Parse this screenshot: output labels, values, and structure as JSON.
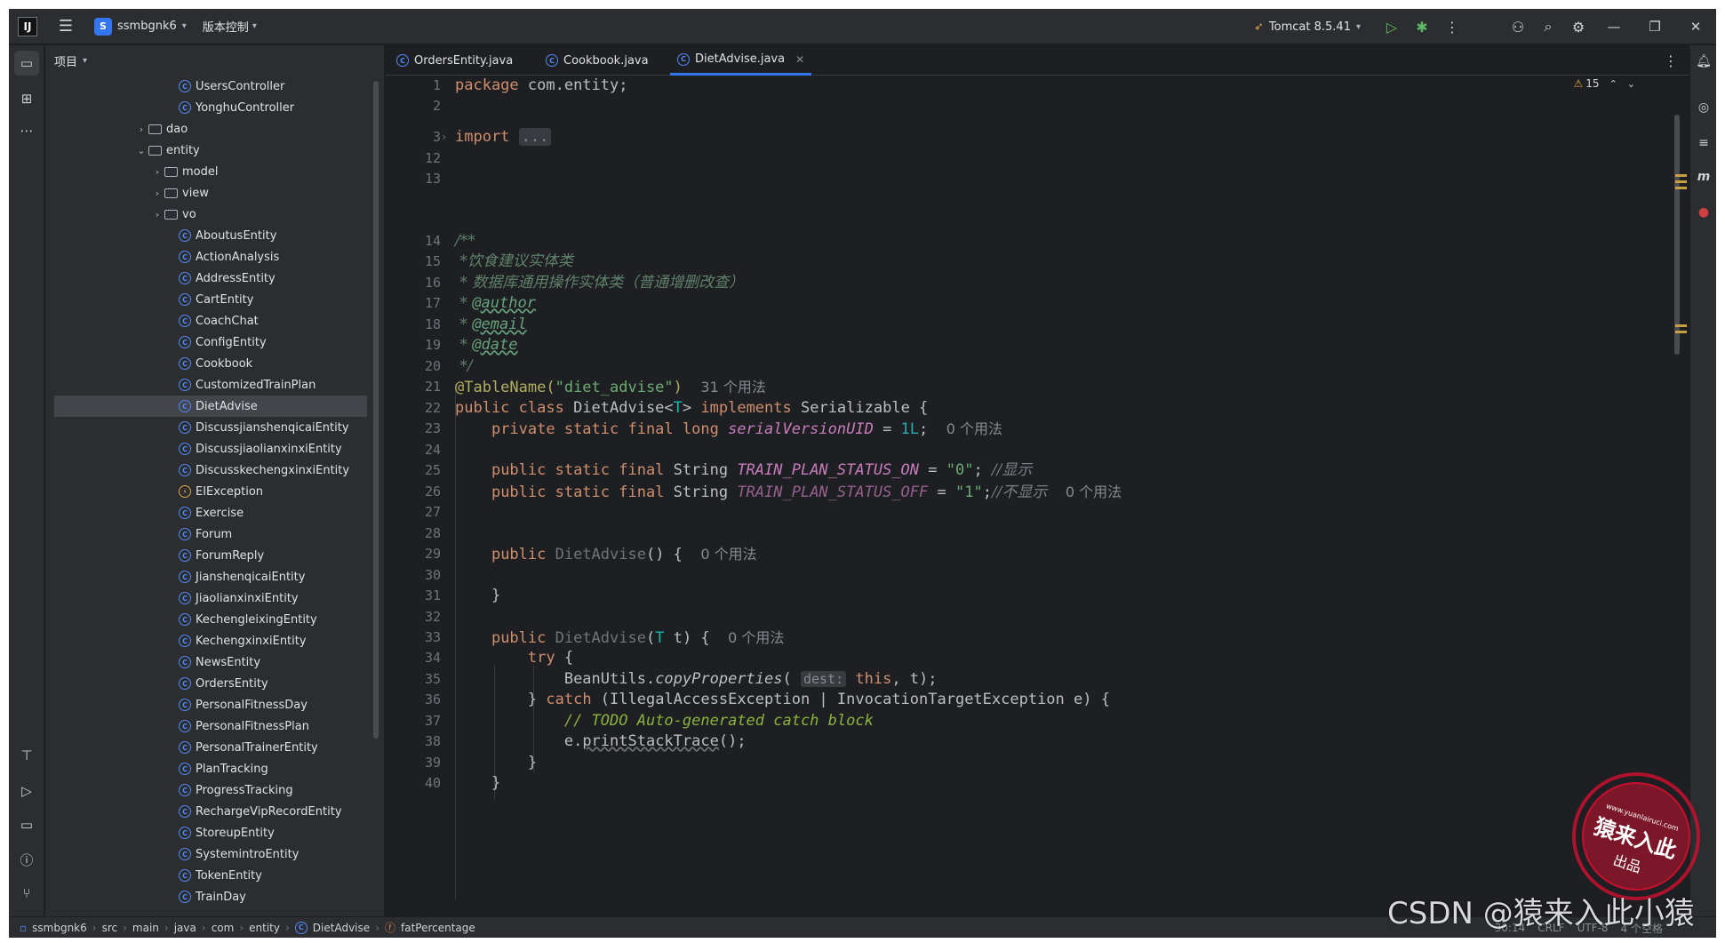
{
  "titlebar": {
    "logo": "IJ",
    "project_badge": "S",
    "project_name": "ssmbgnk6",
    "vcs_label": "版本控制",
    "run_config": "Tomcat 8.5.41"
  },
  "project_panel": {
    "title": "项目",
    "items": [
      {
        "label": "UsersController",
        "kind": "class",
        "indent": 2
      },
      {
        "label": "YonghuController",
        "kind": "class",
        "indent": 2
      },
      {
        "label": "dao",
        "kind": "folder",
        "indent": 1,
        "expanded": false
      },
      {
        "label": "entity",
        "kind": "folder",
        "indent": 1,
        "expanded": true
      },
      {
        "label": "model",
        "kind": "folder",
        "indent": 2,
        "expanded": false
      },
      {
        "label": "view",
        "kind": "folder",
        "indent": 2,
        "expanded": false
      },
      {
        "label": "vo",
        "kind": "folder",
        "indent": 2,
        "expanded": false
      },
      {
        "label": "AboutusEntity",
        "kind": "class",
        "indent": 2
      },
      {
        "label": "ActionAnalysis",
        "kind": "class",
        "indent": 2
      },
      {
        "label": "AddressEntity",
        "kind": "class",
        "indent": 2
      },
      {
        "label": "CartEntity",
        "kind": "class",
        "indent": 2
      },
      {
        "label": "CoachChat",
        "kind": "class",
        "indent": 2
      },
      {
        "label": "ConfigEntity",
        "kind": "class",
        "indent": 2
      },
      {
        "label": "Cookbook",
        "kind": "class",
        "indent": 2
      },
      {
        "label": "CustomizedTrainPlan",
        "kind": "class",
        "indent": 2
      },
      {
        "label": "DietAdvise",
        "kind": "class",
        "indent": 2,
        "selected": true
      },
      {
        "label": "DiscussjianshenqicaiEntity",
        "kind": "class",
        "indent": 2
      },
      {
        "label": "DiscussjiaolianxinxiEntity",
        "kind": "class",
        "indent": 2
      },
      {
        "label": "DiscusskechengxinxiEntity",
        "kind": "class",
        "indent": 2
      },
      {
        "label": "EIException",
        "kind": "exception",
        "indent": 2
      },
      {
        "label": "Exercise",
        "kind": "class",
        "indent": 2
      },
      {
        "label": "Forum",
        "kind": "class",
        "indent": 2
      },
      {
        "label": "ForumReply",
        "kind": "class",
        "indent": 2
      },
      {
        "label": "JianshenqicaiEntity",
        "kind": "class",
        "indent": 2
      },
      {
        "label": "JiaolianxinxiEntity",
        "kind": "class",
        "indent": 2
      },
      {
        "label": "KechengleixingEntity",
        "kind": "class",
        "indent": 2
      },
      {
        "label": "KechengxinxiEntity",
        "kind": "class",
        "indent": 2
      },
      {
        "label": "NewsEntity",
        "kind": "class",
        "indent": 2
      },
      {
        "label": "OrdersEntity",
        "kind": "class",
        "indent": 2
      },
      {
        "label": "PersonalFitnessDay",
        "kind": "class",
        "indent": 2
      },
      {
        "label": "PersonalFitnessPlan",
        "kind": "class",
        "indent": 2
      },
      {
        "label": "PersonalTrainerEntity",
        "kind": "class",
        "indent": 2
      },
      {
        "label": "PlanTracking",
        "kind": "class",
        "indent": 2
      },
      {
        "label": "ProgressTracking",
        "kind": "class",
        "indent": 2
      },
      {
        "label": "RechargeVipRecordEntity",
        "kind": "class",
        "indent": 2
      },
      {
        "label": "StoreupEntity",
        "kind": "class",
        "indent": 2
      },
      {
        "label": "SystemintroEntity",
        "kind": "class",
        "indent": 2
      },
      {
        "label": "TokenEntity",
        "kind": "class",
        "indent": 2
      },
      {
        "label": "TrainDay",
        "kind": "class",
        "indent": 2
      }
    ]
  },
  "editor": {
    "tabs": [
      {
        "label": "OrdersEntity.java",
        "active": false
      },
      {
        "label": "Cookbook.java",
        "active": false
      },
      {
        "label": "DietAdvise.java",
        "active": true
      }
    ],
    "warnings_count": "15",
    "line_numbers": [
      "1",
      "2",
      "3",
      "12",
      "13",
      "14",
      "15",
      "16",
      "17",
      "18",
      "19",
      "20",
      "21",
      "22",
      "23",
      "24",
      "25",
      "26",
      "27",
      "28",
      "29",
      "30",
      "31",
      "32",
      "33",
      "34",
      "35",
      "36",
      "37",
      "38",
      "39",
      "40"
    ],
    "code": {
      "l1_kw": "package",
      "l1_rest": " com.entity;",
      "l3_kw": "import",
      "l3_fold": "...",
      "l14": "/**",
      "l15": " *饮食建议实体类",
      "l16": " * 数据库通用操作实体类（普通增删改查）",
      "l17_star": " * ",
      "l17_tag": "@author",
      "l18_star": " * ",
      "l18_tag": "@email",
      "l19_star": " * ",
      "l19_tag": "@date",
      "l20": " */",
      "l21_ann": "@TableName(",
      "l21_str": "\"diet_advise\"",
      "l21_close": ")",
      "l21_hint": "31 个用法",
      "l22_kw1": "public class ",
      "l22_name": "DietAdvise<",
      "l22_tp": "T",
      "l22_mid": "> ",
      "l22_kw2": "implements",
      "l22_rest": " Serializable {",
      "l23_kw": "private static final long ",
      "l23_fld": "serialVersionUID",
      "l23_eq": " = ",
      "l23_num": "1L",
      "l23_semi": ";",
      "l23_hint": "0 个用法",
      "l25_kw": "public static final ",
      "l25_type": "String ",
      "l25_fld": "TRAIN_PLAN_STATUS_ON",
      "l25_eq": " = ",
      "l25_str": "\"0\"",
      "l25_semi": "; ",
      "l25_cm": "//显示",
      "l26_kw": "public static final ",
      "l26_type": "String ",
      "l26_fld": "TRAIN_PLAN_STATUS_OFF",
      "l26_eq": " = ",
      "l26_str": "\"1\"",
      "l26_semi": ";",
      "l26_cm": "//不显示",
      "l26_hint": "0 个用法",
      "l29_kw": "public ",
      "l29_name": "DietAdvise",
      "l29_rest": "() { ",
      "l29_hint": "0 个用法",
      "l31": "}",
      "l33_kw": "public ",
      "l33_name": "DietAdvise",
      "l33_p1": "(",
      "l33_tp": "T",
      "l33_p2": " t) { ",
      "l33_hint": "0 个用法",
      "l34_kw": "try",
      "l34_rest": " {",
      "l35_a": "BeanUtils.",
      "l35_m": "copyProperties",
      "l35_b": "( ",
      "l35_inlay": "dest:",
      "l35_kw": " this",
      "l35_c": ", t);",
      "l36_a": "} ",
      "l36_kw": "catch",
      "l36_b": " (IllegalAccessException | InvocationTargetException e) {",
      "l37_cm": "// ",
      "l37_todo": "TODO Auto-generated catch block",
      "l38_a": "e.",
      "l38_m": "printStackTrace",
      "l38_b": "();",
      "l39": "}",
      "l40": "}"
    }
  },
  "statusbar": {
    "crumbs": [
      "ssmbgnk6",
      "src",
      "main",
      "java",
      "com",
      "entity",
      "DietAdvise",
      "fatPercentage"
    ],
    "right_items": [
      "30:14",
      "CRLF",
      "UTF-8",
      "4 个空格"
    ]
  },
  "watermark": {
    "csdn": "CSDN @猿来入此小猿",
    "seal_top": "www.yuanlairuci.com",
    "seal_main": "猿来入此",
    "seal_bottom": "出品"
  },
  "colors": {
    "background": "#1e1f22",
    "panel": "#2b2d30",
    "accent": "#3574f0",
    "keyword": "#cf8e6d",
    "string": "#6aab73",
    "seal": "#c8102e"
  }
}
